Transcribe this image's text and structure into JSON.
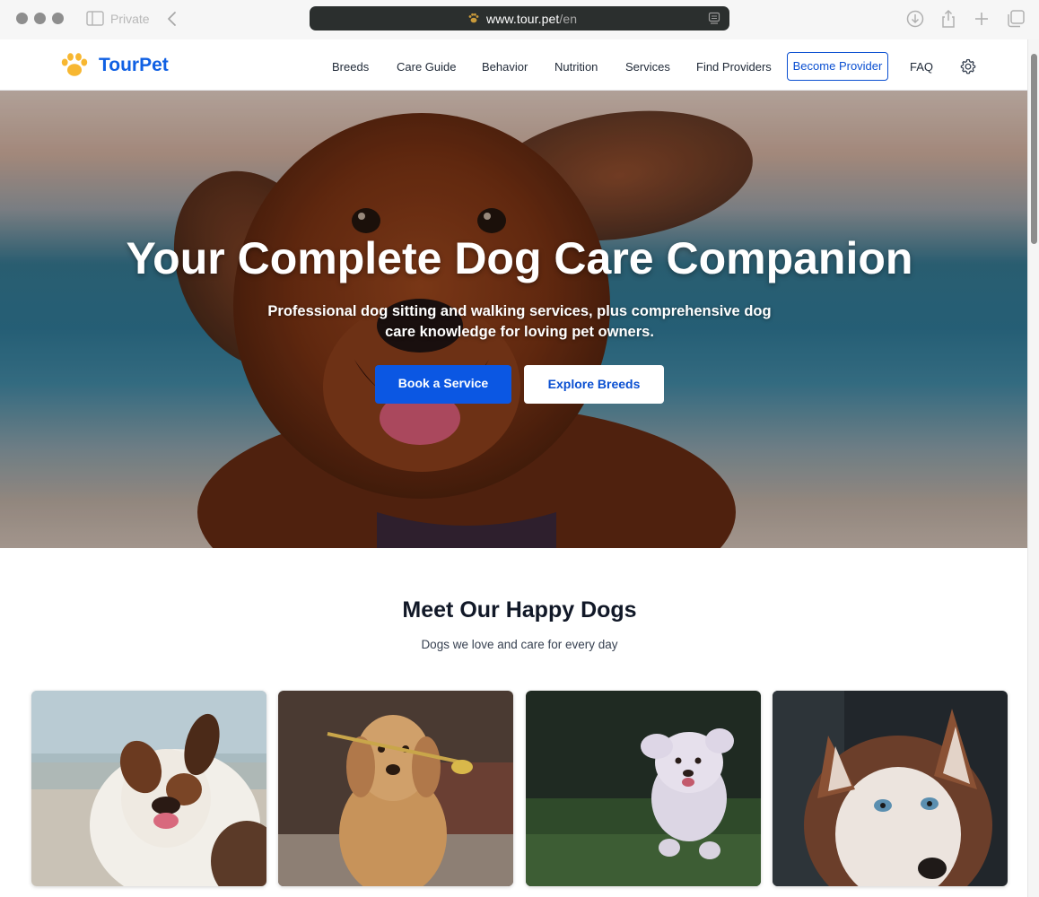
{
  "browser": {
    "private_label": "Private",
    "url_host": "www.tour.pet",
    "url_path": "/en"
  },
  "site": {
    "logo_text": "TourPet",
    "nav": {
      "breeds": "Breeds",
      "care_guide": "Care Guide",
      "behavior": "Behavior",
      "nutrition": "Nutrition",
      "services": "Services",
      "find_providers": "Find Providers",
      "become_provider": "Become Provider",
      "faq": "FAQ"
    }
  },
  "hero": {
    "title": "Your Complete Dog Care Companion",
    "subtitle": "Professional dog sitting and walking services, plus comprehensive dog care knowledge for loving pet owners.",
    "primary_button": "Book a Service",
    "secondary_button": "Explore Breeds"
  },
  "happy_dogs": {
    "title": "Meet Our Happy Dogs",
    "subtitle": "Dogs we love and care for every day",
    "cards": [
      {
        "icon": "dog-photo-australian-shepherd"
      },
      {
        "icon": "dog-photo-golden-retriever"
      },
      {
        "icon": "dog-photo-white-poodle"
      },
      {
        "icon": "dog-photo-husky"
      }
    ]
  },
  "colors": {
    "brand_blue": "#0b57e3",
    "logo_yellow": "#f7b731"
  }
}
